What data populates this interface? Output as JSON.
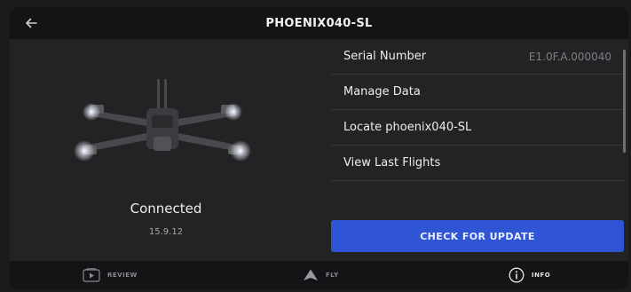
{
  "header": {
    "title": "PHOENIX040-SL",
    "back_icon": "arrow-left-icon"
  },
  "device": {
    "image_icon": "drone-image",
    "status": "Connected",
    "version": "15.9.12"
  },
  "menu": {
    "items": [
      {
        "label": "Serial Number",
        "value": "E1.0F.A.000040"
      },
      {
        "label": "Manage Data",
        "value": ""
      },
      {
        "label": "Locate phoenix040-SL",
        "value": ""
      },
      {
        "label": "View Last Flights",
        "value": ""
      }
    ]
  },
  "update_button": {
    "label": "CHECK FOR UPDATE"
  },
  "nav": {
    "items": [
      {
        "label": "REVIEW",
        "icon": "review-play-icon"
      },
      {
        "label": "FLY",
        "icon": "fly-arrow-icon"
      },
      {
        "label": "INFO",
        "icon": "info-icon"
      }
    ],
    "active": "INFO"
  },
  "colors": {
    "accent": "#2f55d4",
    "background": "#232325",
    "bars": "#141416"
  }
}
